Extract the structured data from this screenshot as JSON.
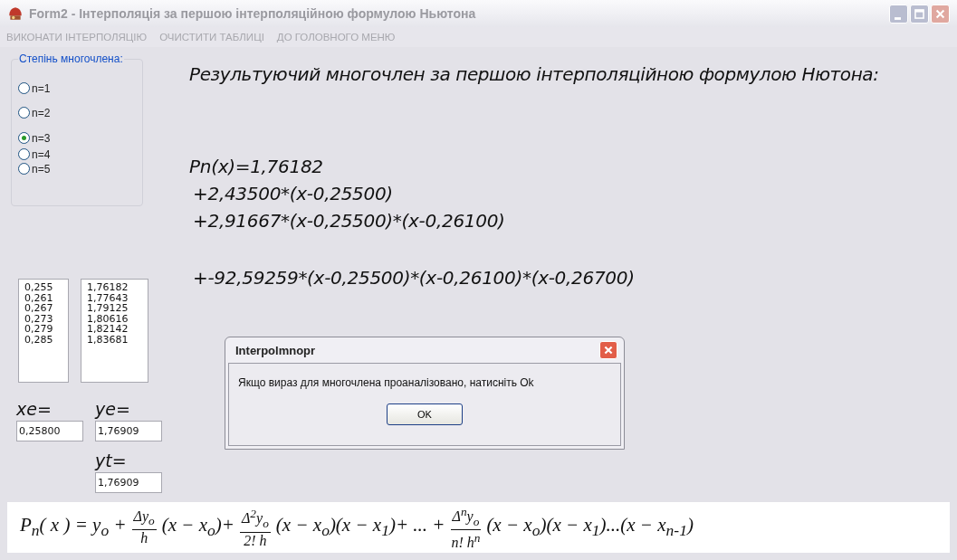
{
  "window": {
    "title": "Form2 - Інтерполяція за першою інтерполяційною формулою Ньютона"
  },
  "menu": [
    {
      "label": "ВИКОНАТИ ІНТЕРПОЛЯЦІЮ"
    },
    {
      "label": "ОЧИСТИТИ ТАБЛИЦІ"
    },
    {
      "label": "ДО ГОЛОВНОГО МЕНЮ"
    }
  ],
  "degree_group": {
    "title": "Степінь многочлена:",
    "options": [
      {
        "label": "n=1",
        "selected": false
      },
      {
        "label": "n=2",
        "selected": false
      },
      {
        "label": "n=3",
        "selected": true
      },
      {
        "label": "n=4",
        "selected": false
      },
      {
        "label": "n=5",
        "selected": false
      }
    ]
  },
  "result": {
    "heading": "Результуючий многочлен за першою інтерполяційною формулою Нютона:",
    "lines": [
      "Pn(x)=1,76182",
      "+2,43500*(x-0,25500)",
      "+2,91667*(x-0,25500)*(x-0,26100)",
      "+-92,59259*(x-0,25500)*(x-0,26100)*(x-0,26700)"
    ]
  },
  "x_values": [
    "0,255",
    "0,261",
    "0,267",
    "0,273",
    "0,279",
    "0,285"
  ],
  "y_values": [
    "1,76182",
    "1,77643",
    "1,79125",
    "1,80616",
    "1,82142",
    "1,83681"
  ],
  "xe": {
    "label": "xe=",
    "value": "0,25800"
  },
  "ye": {
    "label": "ye=",
    "value": "1,76909"
  },
  "yt": {
    "label": "yt=",
    "value": "1,76909"
  },
  "formula": [
    {
      "kind": "text",
      "text": "P$_{n}$( x ) = y$_{o}$ +"
    },
    {
      "kind": "frac",
      "num": "Δy$_{o}$",
      "den": "h"
    },
    {
      "kind": "text",
      "text": "(x − x$_{o}$)+"
    },
    {
      "kind": "frac",
      "num": "Δ$^{2}$y$_{o}$",
      "den": "2! h"
    },
    {
      "kind": "text",
      "text": "(x − x$_{o}$)(x − x$_{1}$)+ ... +"
    },
    {
      "kind": "frac",
      "num": "Δ$^{n}$y$_{o}$",
      "den": "n! h$^{n}$"
    },
    {
      "kind": "text",
      "text": "(x − x$_{o}$)(x − x$_{1}$)...(x − x$_{n-1}$)"
    }
  ],
  "dialog": {
    "title": "Interpolmnopr",
    "message": "Якщо вираз для многочлена проаналізовано, натисніть Ok",
    "button": "OK"
  }
}
